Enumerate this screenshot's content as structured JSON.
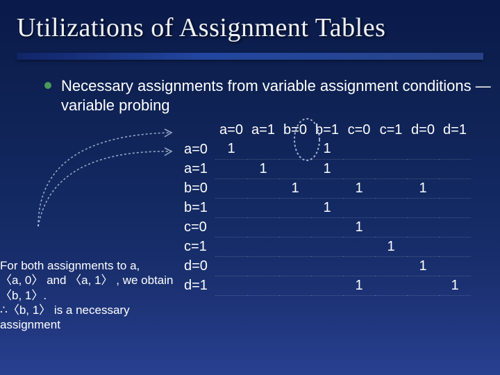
{
  "title": "Utilizations of Assignment Tables",
  "bullet": "Necessary assignments from variable assignment conditions — variable probing",
  "table": {
    "col_headers": [
      "a=0",
      "a=1",
      "b=0",
      "b=1",
      "c=0",
      "c=1",
      "d=0",
      "d=1"
    ],
    "row_headers": [
      "a=0",
      "a=1",
      "b=0",
      "b=1",
      "c=0",
      "c=1",
      "d=0",
      "d=1"
    ],
    "cells": [
      [
        "1",
        "",
        "",
        "1",
        "",
        "",
        "",
        ""
      ],
      [
        "",
        "1",
        "",
        "1",
        "",
        "",
        "",
        ""
      ],
      [
        "",
        "",
        "1",
        "",
        "1",
        "",
        "1",
        ""
      ],
      [
        "",
        "",
        "",
        "1",
        "",
        "",
        "",
        ""
      ],
      [
        "",
        "",
        "",
        "",
        "1",
        "",
        "",
        ""
      ],
      [
        "",
        "",
        "",
        "",
        "",
        "1",
        "",
        ""
      ],
      [
        "",
        "",
        "",
        "",
        "",
        "",
        "1",
        ""
      ],
      [
        "",
        "",
        "",
        "",
        "1",
        "",
        "",
        "1"
      ]
    ]
  },
  "annotation": {
    "line1": "For both assignments to a,",
    "line2_a": "〈a, 0〉",
    "line2_mid": " and ",
    "line2_b": "〈a, 1〉",
    "line2_end": " , we obtain",
    "line3": "〈b, 1〉.",
    "line4_pre": "∴",
    "line4_b": "〈b, 1〉",
    "line4_end": " is a necessary",
    "line5": "assignment"
  }
}
